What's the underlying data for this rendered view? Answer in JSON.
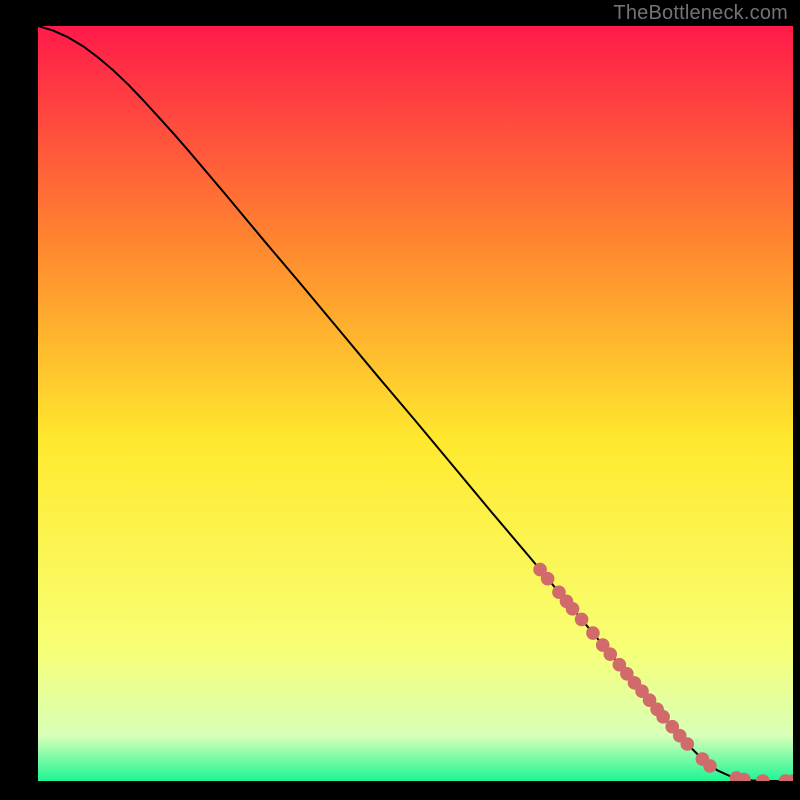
{
  "attribution": "TheBottleneck.com",
  "chart_data": {
    "type": "line",
    "title": "",
    "xlabel": "",
    "ylabel": "",
    "xlim": [
      0,
      100
    ],
    "ylim": [
      0,
      100
    ],
    "grid": false,
    "legend": false,
    "background": {
      "colors": {
        "top": "#ff1a4a",
        "upper_mid": "#ff8b2e",
        "mid": "#ffe92e",
        "lower_mid": "#f8ff73",
        "near_bottom": "#d8ffb8",
        "bottom": "#1df594"
      }
    },
    "curve": {
      "color": "#000000",
      "x": [
        0,
        2,
        4,
        6,
        8,
        10,
        12,
        14,
        16,
        18,
        20,
        25,
        30,
        35,
        40,
        45,
        50,
        55,
        60,
        65,
        70,
        75,
        80,
        83,
        86,
        88,
        90,
        92,
        94,
        96,
        98,
        100
      ],
      "y": [
        100,
        99.4,
        98.5,
        97.3,
        95.8,
        94.1,
        92.2,
        90.1,
        87.9,
        85.7,
        83.4,
        77.5,
        71.5,
        65.6,
        59.6,
        53.6,
        47.7,
        41.7,
        35.7,
        29.8,
        23.8,
        17.8,
        11.9,
        8.3,
        4.9,
        2.9,
        1.4,
        0.5,
        0.1,
        0,
        0,
        0
      ]
    },
    "markers": {
      "color": "#d16a6a",
      "radius_chart_units": 0.9,
      "x": [
        66.5,
        67.5,
        69,
        70,
        70.8,
        72,
        73.5,
        74.8,
        75.8,
        77,
        78,
        79,
        80,
        81,
        82,
        82.8,
        84,
        85,
        86,
        88,
        89,
        92.5,
        93.5,
        96,
        99,
        100
      ],
      "y": [
        28,
        26.8,
        25,
        23.8,
        22.8,
        21.4,
        19.6,
        18,
        16.8,
        15.4,
        14.2,
        13,
        11.9,
        10.7,
        9.5,
        8.5,
        7.2,
        6,
        4.9,
        2.9,
        2,
        0.4,
        0.2,
        0,
        0,
        0
      ]
    }
  }
}
